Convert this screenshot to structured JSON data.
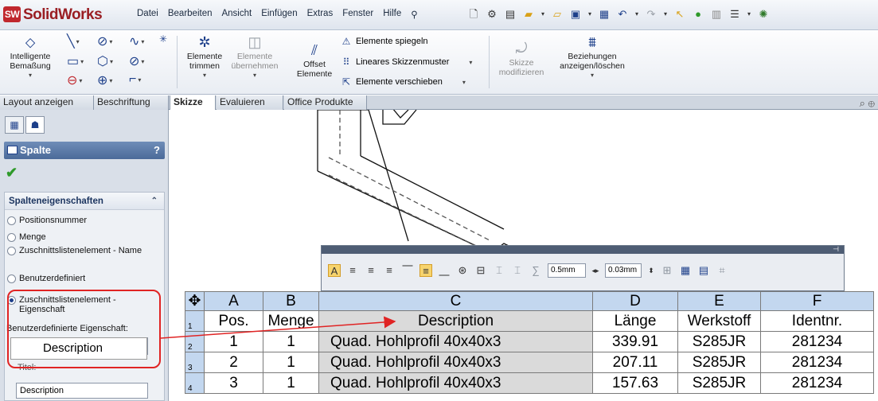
{
  "app": {
    "name": "SolidWorks",
    "logo_badge": "SW"
  },
  "menu": [
    "Datei",
    "Bearbeiten",
    "Ansicht",
    "Einfügen",
    "Extras",
    "Fenster",
    "Hilfe"
  ],
  "ribbon": {
    "smart_dim": [
      "Intelligente",
      "Bemaßung"
    ],
    "trim": [
      "Elemente",
      "trimmen"
    ],
    "convert": [
      "Elemente",
      "übernehmen"
    ],
    "offset": [
      "Offset",
      "Elemente"
    ],
    "mirror": "Elemente spiegeln",
    "linear_pattern": "Lineares Skizzenmuster",
    "move": "Elemente verschieben",
    "modify": [
      "Skizze",
      "modifizieren"
    ],
    "relations": [
      "Beziehungen",
      "anzeigen/löschen"
    ]
  },
  "tabs": [
    "Layout anzeigen",
    "Beschriftung",
    "Skizze",
    "Evaluieren",
    "Office Produkte"
  ],
  "panel": {
    "title": "Spalte",
    "help": "?",
    "group_title": "Spalteneigenschaften",
    "options": [
      {
        "label": "Positionsnummer",
        "selected": false
      },
      {
        "label": "Menge",
        "selected": false
      },
      {
        "label": "Zuschnittslistenelement - Name",
        "selected": false
      },
      {
        "label": "Benutzerdefiniert",
        "selected": false
      },
      {
        "label": "Zuschnittslistenelement - Eigenschaft",
        "selected": true
      }
    ],
    "custom_property_label": "Benutzerdefinierte Eigenschaft:",
    "custom_property_value": "Description",
    "title_label": "Titel:",
    "title_value": "Description"
  },
  "format_toolbar": {
    "line_width": "0.5mm",
    "line_width_2": "0.03mm"
  },
  "table": {
    "columns": [
      "A",
      "B",
      "C",
      "D",
      "E",
      "F"
    ],
    "header": [
      "Pos.",
      "Menge",
      "Description",
      "Länge",
      "Werkstoff",
      "Identnr."
    ],
    "rows": [
      [
        "1",
        "1",
        "Quad. Hohlprofil 40x40x3",
        "339.91",
        "S285JR",
        "281234"
      ],
      [
        "2",
        "1",
        "Quad. Hohlprofil 40x40x3",
        "207.11",
        "S285JR",
        "281234"
      ],
      [
        "3",
        "1",
        "Quad. Hohlprofil 40x40x3",
        "157.63",
        "S285JR",
        "281234"
      ]
    ],
    "row_numbers": [
      "1",
      "2",
      "3",
      "4"
    ]
  },
  "colors": {
    "accent": "#1d3f8a",
    "callout": "#e02424",
    "header_fill": "#c3d7ef"
  }
}
